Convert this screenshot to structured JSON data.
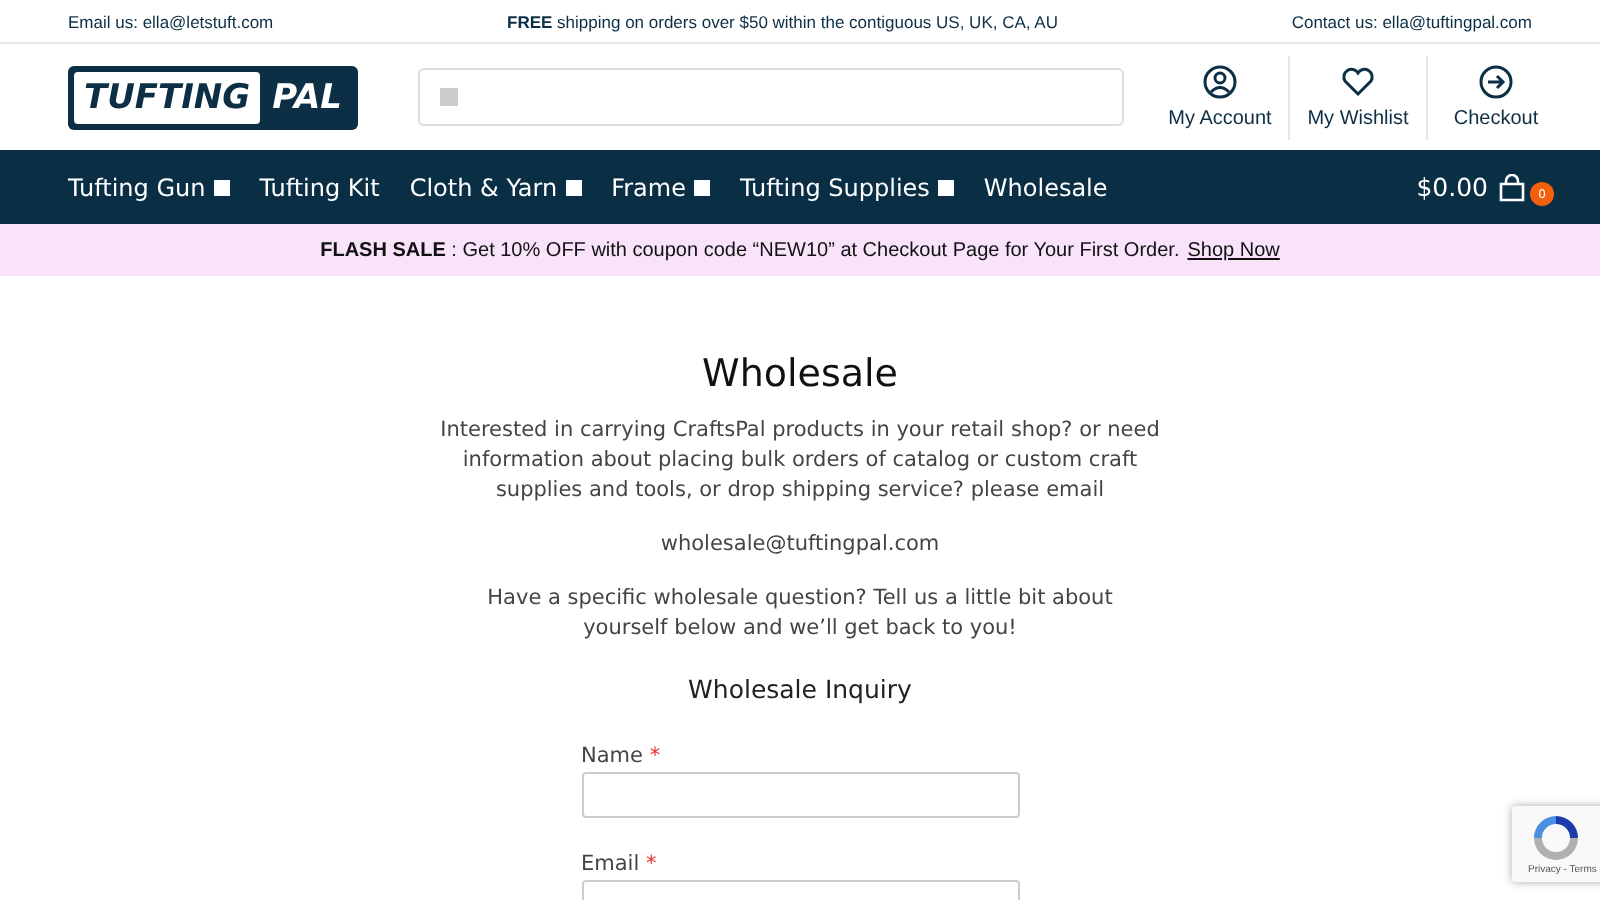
{
  "top_bar": {
    "left": "Email us: ella@letstuft.com",
    "center_bold": "FREE",
    "center": "shipping on orders over $50 within the contiguous US, UK, CA, AU",
    "right": "Contact us: ella@tuftingpal.com"
  },
  "logo": {
    "word_1": "TUFTING",
    "word_2": "PAL"
  },
  "header_links": [
    {
      "label": "My Account"
    },
    {
      "label": "My Wishlist"
    },
    {
      "label": "Checkout"
    }
  ],
  "nav": [
    {
      "label": "Tufting Gun",
      "has_dropdown": true
    },
    {
      "label": "Tufting Kit",
      "has_dropdown": false
    },
    {
      "label": "Cloth & Yarn",
      "has_dropdown": true
    },
    {
      "label": "Frame",
      "has_dropdown": true
    },
    {
      "label": "Tufting Supplies",
      "has_dropdown": true
    },
    {
      "label": "Wholesale",
      "has_dropdown": false
    }
  ],
  "cart": {
    "total": "$0.00",
    "count": "0"
  },
  "flash_sale": {
    "text": "**FLASH SALE** : Get 10% OFF with coupon code “NEW10” at Checkout Page for Your First Order.",
    "link": "Shop Now"
  },
  "page": {
    "title": "Wholesale",
    "intro": "Interested in carrying CraftsPal products in your retail shop? or need information about placing bulk orders of catalog or custom craft supplies and tools, or drop shipping service? please email",
    "email": "wholesale@tuftingpal.com",
    "question": "Have a specific wholesale question? Tell us a little bit about yourself below and we’ll get back to you!",
    "form_title": "Wholesale Inquiry"
  },
  "form_fields": [
    {
      "label": "Name",
      "required_mark": "*"
    },
    {
      "label": "Email",
      "required_mark": "*"
    }
  ],
  "recaptcha": {
    "links": "Privacy - Terms"
  }
}
